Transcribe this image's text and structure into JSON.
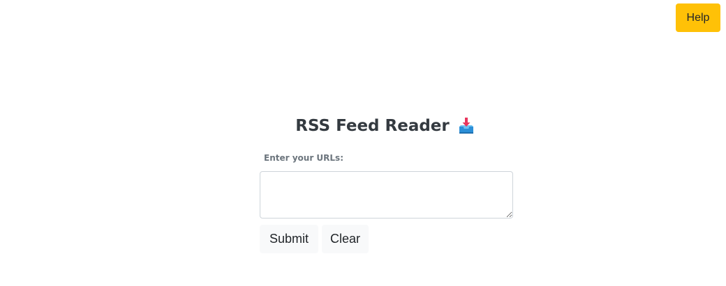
{
  "header": {
    "help_label": "Help"
  },
  "main": {
    "title": "RSS Feed Reader",
    "title_icon": "inbox-tray-icon",
    "url_label": "Enter your URLs:",
    "url_input": {
      "value": "",
      "placeholder": ""
    },
    "submit_label": "Submit",
    "clear_label": "Clear"
  },
  "colors": {
    "help_button": "#ffc107",
    "action_button": "#f8f9fa",
    "title_text": "#343a40",
    "label_text": "#6c757d",
    "input_border": "#ced4da"
  }
}
